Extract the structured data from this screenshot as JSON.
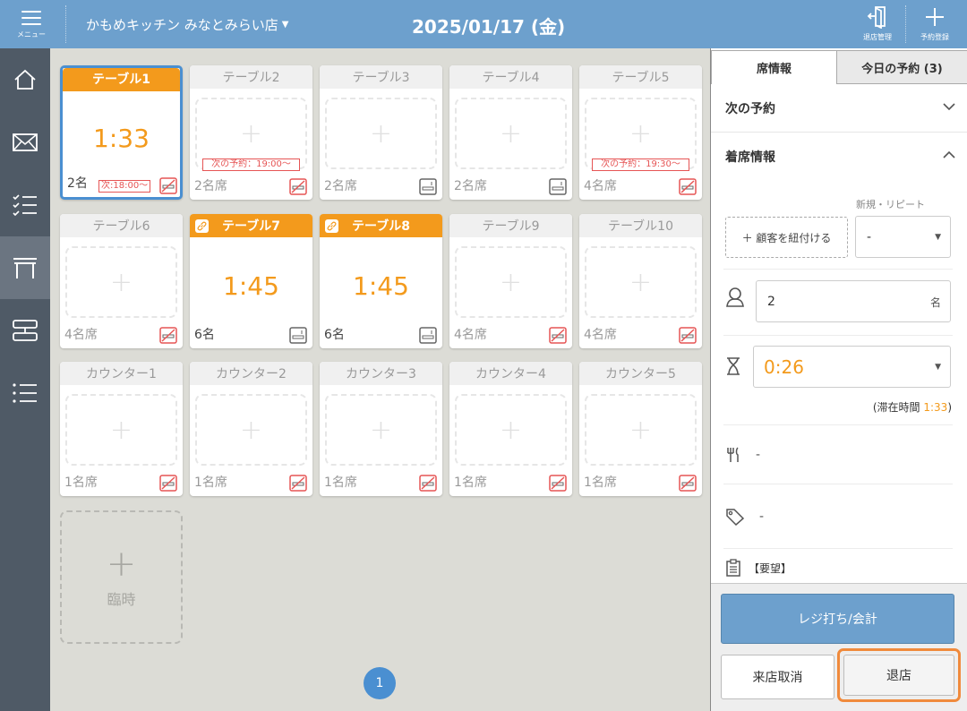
{
  "header": {
    "menu_label": "メニュー",
    "store_name": "かもめキッチン みなとみらい店",
    "date": "2025/01/17 (金)",
    "checkout_mgmt_label": "退店管理",
    "new_reservation_label": "予約登録"
  },
  "sidebar": {
    "items": [
      {
        "name": "home",
        "active": false
      },
      {
        "name": "mail",
        "active": false
      },
      {
        "name": "checklist",
        "active": false
      },
      {
        "name": "table",
        "active": true
      },
      {
        "name": "layout",
        "active": false
      },
      {
        "name": "list",
        "active": false
      }
    ]
  },
  "tables": [
    {
      "name": "テーブル1",
      "seats": "2名",
      "occupied": true,
      "time": "1:33",
      "next": "次:18:00～",
      "smoking": "no",
      "selected": true
    },
    {
      "name": "テーブル2",
      "seats": "2名席",
      "occupied": false,
      "next": "次の予約：19:00～",
      "smoking": "no"
    },
    {
      "name": "テーブル3",
      "seats": "2名席",
      "occupied": false,
      "smoking": "yes"
    },
    {
      "name": "テーブル4",
      "seats": "2名席",
      "occupied": false,
      "smoking": "yes"
    },
    {
      "name": "テーブル5",
      "seats": "4名席",
      "occupied": false,
      "next": "次の予約：19:30～",
      "smoking": "no"
    },
    {
      "name": "テーブル6",
      "seats": "4名席",
      "occupied": false,
      "smoking": "no"
    },
    {
      "name": "テーブル7",
      "seats": "6名",
      "occupied": true,
      "time": "1:45",
      "linked": true,
      "smoking": "yes"
    },
    {
      "name": "テーブル8",
      "seats": "6名",
      "occupied": true,
      "time": "1:45",
      "linked": true,
      "smoking": "yes"
    },
    {
      "name": "テーブル9",
      "seats": "4名席",
      "occupied": false,
      "smoking": "no"
    },
    {
      "name": "テーブル10",
      "seats": "4名席",
      "occupied": false,
      "smoking": "no"
    },
    {
      "name": "カウンター1",
      "seats": "1名席",
      "occupied": false,
      "smoking": "no"
    },
    {
      "name": "カウンター2",
      "seats": "1名席",
      "occupied": false,
      "smoking": "no"
    },
    {
      "name": "カウンター3",
      "seats": "1名席",
      "occupied": false,
      "smoking": "no"
    },
    {
      "name": "カウンター4",
      "seats": "1名席",
      "occupied": false,
      "smoking": "no"
    },
    {
      "name": "カウンター5",
      "seats": "1名席",
      "occupied": false,
      "smoking": "no"
    }
  ],
  "temp_table": {
    "plus": "+",
    "label": "臨時"
  },
  "pagination": {
    "current": "1"
  },
  "panel": {
    "tab_seat_info": "席情報",
    "tab_today_reservations": "今日の予約 (3)",
    "next_reservation_heading": "次の予約",
    "seating_info_heading": "着席情報",
    "link_customer_button": "＋ 顧客を紐付ける",
    "new_repeat_label": "新規・リピート",
    "new_repeat_value": "-",
    "party_size": "2",
    "party_unit": "名",
    "stay_select_value": "0:26",
    "stay_note_prefix": "(滞在時間 ",
    "stay_note_value": "1:33",
    "stay_note_suffix": ")",
    "course_value": "-",
    "tag_value": "-",
    "request_label": "【要望】",
    "pay_button": "レジ打ち/会計",
    "cancel_visit_button": "来店取消",
    "checkout_button": "退店"
  },
  "colors": {
    "header": "#6da0cd",
    "sidebar": "#4f5a66",
    "occupied": "#f39a1c",
    "accent_blue": "#4a8fd1",
    "reservation_red": "#e65555",
    "highlight_orange": "#f08a3c"
  }
}
